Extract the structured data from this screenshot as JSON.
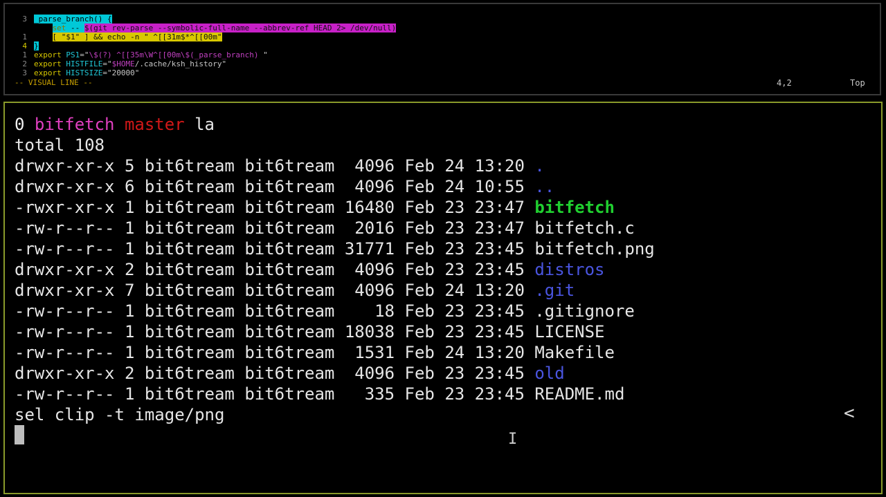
{
  "editor": {
    "lines": [
      {
        "num": "3",
        "segments": [
          {
            "t": "_parse_branch() {",
            "c": "vis"
          }
        ]
      },
      {
        "num": "",
        "segments": [
          {
            "t": "    ",
            "c": "vis-w"
          },
          {
            "t": "set",
            "c": "kw-vis"
          },
          {
            "t": " -- ",
            "c": "vis"
          },
          {
            "t": "$(git rev-parse --symbolic-full-name --abbrev-ref HEAD 2>",
            "c": "vis-mag"
          },
          {
            "t": " /dev/null)",
            "c": "vis-mag"
          }
        ]
      },
      {
        "num": "1",
        "segments": [
          {
            "t": "    ",
            "c": "vis-w"
          },
          {
            "t": "[ \"$1\" ] && echo -n \" ",
            "c": "vis-ylw"
          },
          {
            "t": "^[[31m$*^[[00m\"",
            "c": "vis-ylw"
          }
        ]
      },
      {
        "num": "4",
        "cur": true,
        "segments": [
          {
            "t": "}",
            "c": "vis"
          }
        ]
      },
      {
        "num": "1",
        "segments": [
          {
            "t": "export ",
            "c": "kw"
          },
          {
            "t": "PS1",
            "c": "var"
          },
          {
            "t": "=\"",
            "c": "str"
          },
          {
            "t": "\\$(?) ^[[35m\\W^[[00m\\$(_parse_branch) ",
            "c": "esc"
          },
          {
            "t": "\"",
            "c": "str"
          }
        ]
      },
      {
        "num": "2",
        "segments": [
          {
            "t": "export ",
            "c": "kw"
          },
          {
            "t": "HISTFILE",
            "c": "var"
          },
          {
            "t": "=\"",
            "c": "str"
          },
          {
            "t": "$HOME",
            "c": "esc"
          },
          {
            "t": "/.cache/ksh_history\"",
            "c": "str"
          }
        ]
      },
      {
        "num": "3",
        "segments": [
          {
            "t": "export ",
            "c": "kw"
          },
          {
            "t": "HISTSIZE",
            "c": "var"
          },
          {
            "t": "=\"20000\"",
            "c": "str"
          }
        ]
      }
    ],
    "status_mode": "-- VISUAL LINE --",
    "status_pos": "4,2",
    "status_scroll": "Top"
  },
  "terminal": {
    "prompt": {
      "status": "0",
      "dir": "bitfetch",
      "branch": "master",
      "command": "la"
    },
    "total": "total 108",
    "rows": [
      {
        "perm": "drwxr-xr-x",
        "links": "5",
        "user": "bit6tream",
        "group": "bit6tream",
        "size": "4096",
        "month": "Feb",
        "day": "24",
        "time": "13:20",
        "name": ".",
        "kind": "dir"
      },
      {
        "perm": "drwxr-xr-x",
        "links": "6",
        "user": "bit6tream",
        "group": "bit6tream",
        "size": "4096",
        "month": "Feb",
        "day": "24",
        "time": "10:55",
        "name": "..",
        "kind": "dir"
      },
      {
        "perm": "-rwxr-xr-x",
        "links": "1",
        "user": "bit6tream",
        "group": "bit6tream",
        "size": "16480",
        "month": "Feb",
        "day": "23",
        "time": "23:47",
        "name": "bitfetch",
        "kind": "exe"
      },
      {
        "perm": "-rw-r--r--",
        "links": "1",
        "user": "bit6tream",
        "group": "bit6tream",
        "size": "2016",
        "month": "Feb",
        "day": "23",
        "time": "23:47",
        "name": "bitfetch.c",
        "kind": "file"
      },
      {
        "perm": "-rw-r--r--",
        "links": "1",
        "user": "bit6tream",
        "group": "bit6tream",
        "size": "31771",
        "month": "Feb",
        "day": "23",
        "time": "23:45",
        "name": "bitfetch.png",
        "kind": "file"
      },
      {
        "perm": "drwxr-xr-x",
        "links": "2",
        "user": "bit6tream",
        "group": "bit6tream",
        "size": "4096",
        "month": "Feb",
        "day": "23",
        "time": "23:45",
        "name": "distros",
        "kind": "dir"
      },
      {
        "perm": "drwxr-xr-x",
        "links": "7",
        "user": "bit6tream",
        "group": "bit6tream",
        "size": "4096",
        "month": "Feb",
        "day": "24",
        "time": "13:20",
        "name": ".git",
        "kind": "dir"
      },
      {
        "perm": "-rw-r--r--",
        "links": "1",
        "user": "bit6tream",
        "group": "bit6tream",
        "size": "18",
        "month": "Feb",
        "day": "23",
        "time": "23:45",
        "name": ".gitignore",
        "kind": "file"
      },
      {
        "perm": "-rw-r--r--",
        "links": "1",
        "user": "bit6tream",
        "group": "bit6tream",
        "size": "18038",
        "month": "Feb",
        "day": "23",
        "time": "23:45",
        "name": "LICENSE",
        "kind": "file"
      },
      {
        "perm": "-rw-r--r--",
        "links": "1",
        "user": "bit6tream",
        "group": "bit6tream",
        "size": "1531",
        "month": "Feb",
        "day": "24",
        "time": "13:20",
        "name": "Makefile",
        "kind": "file"
      },
      {
        "perm": "drwxr-xr-x",
        "links": "2",
        "user": "bit6tream",
        "group": "bit6tream",
        "size": "4096",
        "month": "Feb",
        "day": "23",
        "time": "23:45",
        "name": "old",
        "kind": "dir"
      },
      {
        "perm": "-rw-r--r--",
        "links": "1",
        "user": "bit6tream",
        "group": "bit6tream",
        "size": "335",
        "month": "Feb",
        "day": "23",
        "time": "23:45",
        "name": "README.md",
        "kind": "file"
      }
    ],
    "last_command": "sel clip -t image/png",
    "chevron": "<",
    "ibeam": "I"
  }
}
